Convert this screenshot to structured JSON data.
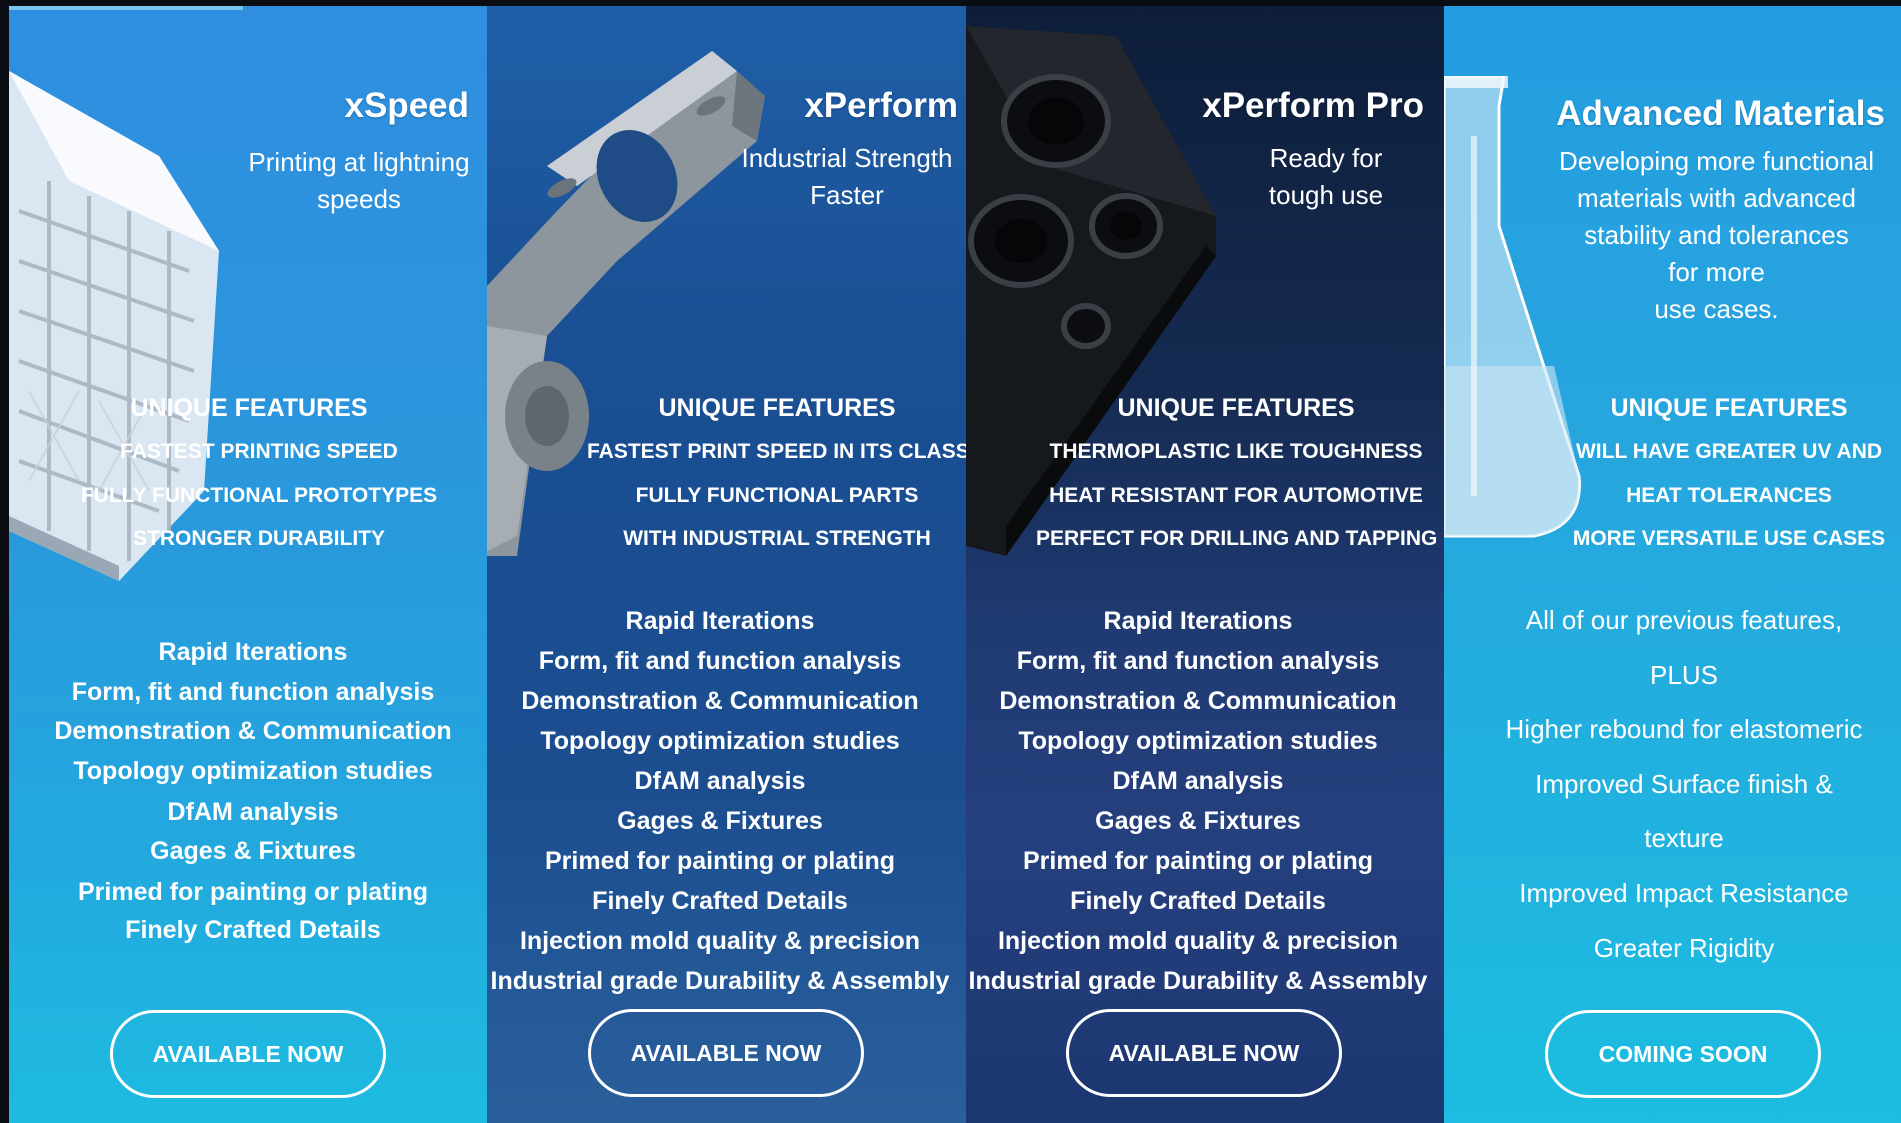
{
  "panels": [
    {
      "title": "xSpeed",
      "tagline_lines": [
        "Printing at lightning",
        "speeds"
      ],
      "features_title": "UNIQUE FEATURES",
      "features": [
        "FASTEST PRINTING SPEED",
        "FULLY FUNCTIONAL PROTOTYPES",
        "STRONGER DURABILITY"
      ],
      "benefits": [
        "Rapid Iterations",
        "Form, fit and function analysis",
        "Demonstration & Communication",
        "Topology optimization studies",
        "DfAM analysis",
        "Gages & Fixtures",
        "Primed for painting or plating",
        "Finely Crafted Details"
      ],
      "button": "AVAILABLE NOW",
      "art_icon": "lattice-print-part-image"
    },
    {
      "title": "xPerform",
      "tagline_lines": [
        "Industrial Strength",
        "Faster"
      ],
      "features_title": "UNIQUE FEATURES",
      "features": [
        "FASTEST PRINT SPEED IN ITS CLASS",
        "FULLY FUNCTIONAL PARTS",
        "WITH INDUSTRIAL STRENGTH"
      ],
      "benefits": [
        "Rapid Iterations",
        "Form, fit and function analysis",
        "Demonstration & Communication",
        "Topology optimization studies",
        "DfAM analysis",
        "Gages & Fixtures",
        "Primed for painting or plating",
        "Finely Crafted Details",
        "Injection mold quality & precision",
        "Industrial grade Durability & Assembly"
      ],
      "button": "AVAILABLE NOW",
      "art_icon": "grey-bracket-part-image"
    },
    {
      "title": "xPerform Pro",
      "tagline_lines": [
        "Ready for",
        "tough use"
      ],
      "features_title": "UNIQUE FEATURES",
      "features": [
        "THERMOPLASTIC LIKE TOUGHNESS",
        "HEAT RESISTANT FOR AUTOMOTIVE",
        "PERFECT FOR DRILLING AND TAPPING"
      ],
      "benefits": [
        "Rapid Iterations",
        "Form, fit and function analysis",
        "Demonstration & Communication",
        "Topology optimization studies",
        "DfAM analysis",
        "Gages & Fixtures",
        "Primed for painting or plating",
        "Finely Crafted Details",
        "Injection mold quality & precision",
        "Industrial grade Durability & Assembly"
      ],
      "button": "AVAILABLE NOW",
      "art_icon": "black-manifold-part-image"
    },
    {
      "title": "Advanced Materials",
      "tagline_lines": [
        "Developing more functional",
        "materials with advanced",
        "stability and tolerances",
        "for more",
        "use cases."
      ],
      "features_title": "UNIQUE FEATURES",
      "features": [
        "WILL HAVE GREATER UV AND",
        "HEAT TOLERANCES",
        "MORE VERSATILE USE CASES"
      ],
      "benefits": [
        "All of our previous features,",
        "PLUS",
        "Higher rebound for elastomeric",
        "Improved Surface finish &",
        "texture",
        "Improved Impact Resistance",
        "Greater Rigidity"
      ],
      "button": "COMING SOON",
      "art_icon": "lab-flask-image"
    }
  ]
}
